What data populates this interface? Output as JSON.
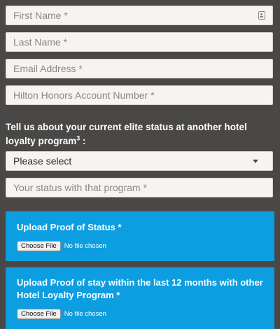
{
  "form": {
    "first_name": {
      "placeholder": "First Name *",
      "icon": "contact-card-icon"
    },
    "last_name": {
      "placeholder": "Last Name *"
    },
    "email": {
      "placeholder": "Email Address *"
    },
    "honors_number": {
      "placeholder": "Hilton Honors Account Number *"
    },
    "loyalty_question": {
      "text": "Tell us about your current elite status at another hotel loyalty program",
      "footnote": "3",
      "suffix": " :"
    },
    "program_select": {
      "selected": "Please select"
    },
    "status": {
      "placeholder": "Your status with that program *"
    }
  },
  "uploads": [
    {
      "title": "Upload Proof of Status *",
      "button": "Choose File",
      "status": "No file chosen"
    },
    {
      "title": "Upload Proof of stay within the last 12 months with other Hotel Loyalty Program *",
      "button": "Choose File",
      "status": "No file chosen"
    }
  ],
  "colors": {
    "background": "#4a4846",
    "input_background": "#f6f4f0",
    "upload_panel": "#0c9ee0"
  }
}
